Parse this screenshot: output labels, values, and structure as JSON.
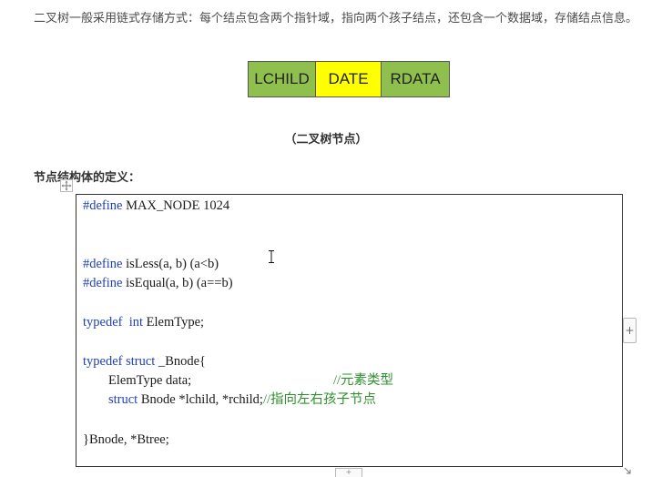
{
  "intro": "二叉树一般采用链式存储方式：每个结点包含两个指针域，指向两个孩子结点，还包含一个数据域，存储结点信息。",
  "node_diagram": {
    "cells": [
      "LCHILD",
      "DATE",
      "RDATA"
    ],
    "colors": {
      "pointer_field": "#8fc04e",
      "data_field": "#ffff00"
    }
  },
  "caption": "（二叉树节点）",
  "section_title": "节点结构体的定义：",
  "code": {
    "line1": {
      "kw": "#define",
      "rest": " MAX_NODE 1024"
    },
    "line2": {
      "kw": "#define",
      "rest": " isLess(a, b) (a<b)"
    },
    "line3": {
      "kw": "#define",
      "rest": " isEqual(a, b) (a==b)"
    },
    "line4": {
      "kw": "typedef",
      "kw2": "int",
      "rest": " ElemType;"
    },
    "line5": {
      "kw": "typedef struct",
      "rest": " _Bnode{"
    },
    "line6": {
      "rest": "ElemType data;",
      "comment": "//元素类型"
    },
    "line7": {
      "kw": "struct",
      "rest": " Bnode *lchild, *rchild;",
      "comment": "//指向左右孩子节点"
    },
    "line8": {
      "rest": "}Bnode, *Btree;"
    }
  },
  "controls": {
    "add_column": "+",
    "add_row": "+",
    "move_icon": "move-icon",
    "resize_icon": "resize-icon"
  }
}
